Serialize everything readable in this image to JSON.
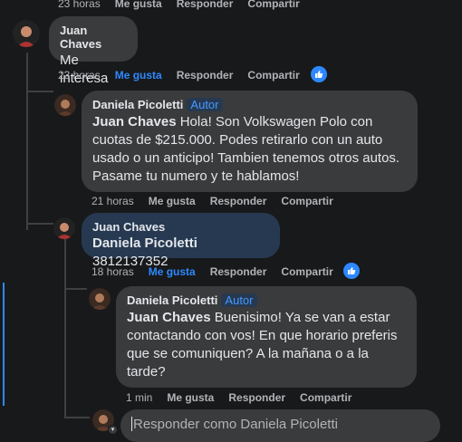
{
  "actions": {
    "like": "Me gusta",
    "reply": "Responder",
    "share": "Compartir"
  },
  "top_row": {
    "time": "23 horas"
  },
  "comment1": {
    "author": "Juan Chaves",
    "text": "Me interesa",
    "time": "23 horas"
  },
  "reply1": {
    "author": "Daniela Picoletti",
    "badge": "Autor",
    "mention": "Juan Chaves",
    "text": " Hola! Son Volkswagen Polo con cuotas de $215.000. Podes retirarlo con un auto usado o un anticipo! Tambien tenemos otros autos. Pasame tu numero y te hablamos!",
    "time": "21 horas"
  },
  "reply2": {
    "author": "Juan Chaves",
    "mention": "Daniela Picoletti",
    "text": " 3812137352",
    "time": "18 horas"
  },
  "reply3": {
    "author": "Daniela Picoletti",
    "badge": "Autor",
    "mention": "Juan Chaves",
    "text": " Buenisimo! Ya se van a estar contactando con vos! En que horario preferis que se comuniquen? A la mañana o a la tarde?",
    "time": "1 min"
  },
  "composer": {
    "placeholder": "Responder como Daniela Picoletti"
  },
  "colors": {
    "accent": "#2d88ff",
    "badge": "#4599ff"
  }
}
